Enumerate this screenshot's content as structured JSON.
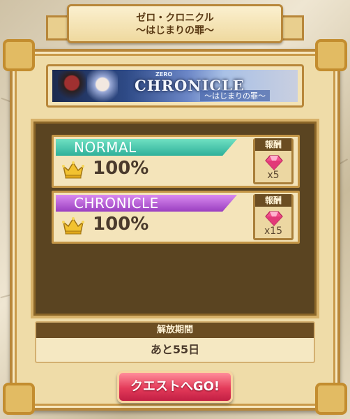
{
  "header": {
    "title_line1": "ゼロ・クロニクル",
    "title_line2": "〜はじまりの罪〜"
  },
  "banner": {
    "logo_small": "ZERO",
    "logo_text": "CHRONICLE",
    "subtitle": "〜はじまりの罪〜"
  },
  "modes": [
    {
      "name": "NORMAL",
      "progress_text": "100%",
      "reward_label": "報酬",
      "reward_icon": "gem-icon",
      "reward_count": "x5",
      "color": "#2fb09a"
    },
    {
      "name": "CHRONICLE",
      "progress_text": "100%",
      "reward_label": "報酬",
      "reward_icon": "gem-icon",
      "reward_count": "x15",
      "color": "#9a3fc0"
    }
  ],
  "period": {
    "label": "解放期間",
    "value": "あと55日"
  },
  "quest_button": {
    "label": "クエストへGO!",
    "color": "#e43b5a"
  }
}
